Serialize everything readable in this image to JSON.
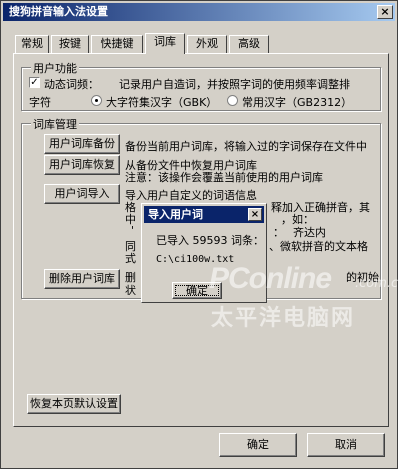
{
  "window": {
    "title": "搜狗拼音输入法设置",
    "close_glyph": "×"
  },
  "tabs": [
    {
      "label": "常规"
    },
    {
      "label": "按键"
    },
    {
      "label": "快捷键"
    },
    {
      "label": "词库"
    },
    {
      "label": "外观"
    },
    {
      "label": "高级"
    }
  ],
  "active_tab": "词库",
  "user_function": {
    "legend": "用户功能",
    "dynamic_checkbox_label": "动态词频：",
    "dynamic_checked": true,
    "dynamic_desc": "记录用户自造词，并按照字词的使用频率调整排",
    "charset_label": "字符",
    "radio_large": "大字符集汉字（GBK）",
    "radio_common": "常用汉字（GB2312）",
    "selected_charset": "large"
  },
  "lexicon": {
    "legend": "词库管理",
    "backup_button": "用户词库备份",
    "backup_desc": "备份当前用户词库，将输入过的字词保存在文件中",
    "restore_button": "用户词库恢复",
    "restore_desc_1": "从备份文件中恢复用户词库",
    "restore_desc_2": "注意：该操作会覆盖当前使用的用户词库",
    "import_button": "用户词导入",
    "import_desc_1": "导入用户自定义的词语信息",
    "import_desc_2a": "格",
    "import_desc_2b": "释加入正确拼音，其",
    "import_desc_3a": "中",
    "import_desc_3b": "，如：",
    "import_desc_4a": "'",
    "import_desc_4b": "：　 齐达内",
    "import_desc_5a": "同",
    "import_desc_5b": "、微软拼音的文本格",
    "import_desc_6a": "式",
    "delete_button": "删除用户词库",
    "delete_desc_1a": "删",
    "delete_desc_1b": "的初始",
    "delete_desc_2a": "状"
  },
  "restore_defaults_button": "恢复本页默认设置",
  "ok_button": "确定",
  "cancel_button": "取消",
  "dialog": {
    "title": "导入用户词",
    "close_glyph": "×",
    "message": "已导入 59593 词条：",
    "path": "C:\\ci100w.txt",
    "ok_button": "确定"
  },
  "watermark": {
    "logo": "PConline",
    "suffix": ".com.cn",
    "chinese": "太平洋电脑网"
  }
}
